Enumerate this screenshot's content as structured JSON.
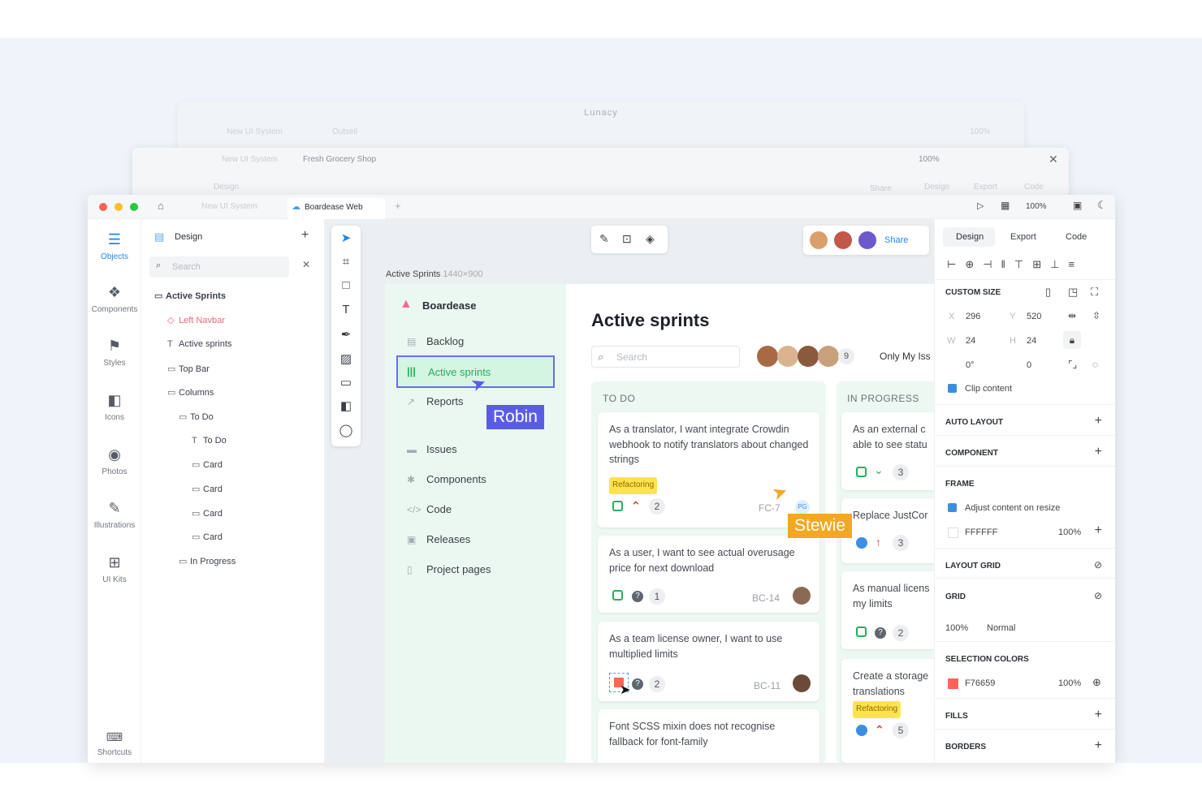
{
  "window_back": {
    "title": "Lunacy",
    "tab1": "New UI System",
    "tab2": "Outsell",
    "zoom": "100%"
  },
  "window_mid": {
    "tab1": "New UI System",
    "tab2": "Fresh Grocery Shop",
    "zoom": "100%",
    "design": "Design",
    "export": "Export",
    "code": "Code",
    "share": "Share"
  },
  "tabs": {
    "home": "home-icon",
    "tab1": "New UI System",
    "tab2": "Boardease Web",
    "zoom": "100%"
  },
  "leftnav": [
    {
      "label": "Objects",
      "icon": "layers-icon"
    },
    {
      "label": "Components",
      "icon": "components-icon"
    },
    {
      "label": "Styles",
      "icon": "paint-roller-icon"
    },
    {
      "label": "Icons",
      "icon": "icons-icon"
    },
    {
      "label": "Photos",
      "icon": "camera-icon"
    },
    {
      "label": "Illustrations",
      "icon": "pen-icon"
    },
    {
      "label": "UI Kits",
      "icon": "grid-icon"
    },
    {
      "label": "Shortcuts",
      "icon": "keyboard-icon"
    }
  ],
  "layers": {
    "page": "Design",
    "search_placeholder": "Search",
    "items": [
      "Active Sprints",
      "Left Navbar",
      "Active sprints",
      "Top Bar",
      "Columns",
      "To Do",
      "To Do",
      "Card",
      "Card",
      "Card",
      "Card",
      "In Progress"
    ]
  },
  "canvas": {
    "frame_name": "Active Sprints",
    "frame_size": "1440×900",
    "share": "Share"
  },
  "app": {
    "brand": "Boardease",
    "menu": [
      "Backlog",
      "Active sprints",
      "Reports",
      "Issues",
      "Components",
      "Code",
      "Releases",
      "Project pages"
    ],
    "title": "Active sprints",
    "search_placeholder": "Search",
    "avatar_count": "9",
    "filter": "Only My Iss",
    "columns": [
      "TO DO",
      "IN PROGRESS"
    ],
    "todo_cards": [
      {
        "text": "As a translator, I want integrate Crowdin webhook to notify translators about changed strings",
        "tag": "Refactoring",
        "count": "2",
        "key": "FC-7"
      },
      {
        "text": "As a user, I want to see actual overusage price for next download",
        "count": "1",
        "key": "BC-14"
      },
      {
        "text": "As a team license owner, I want to use multiplied limits",
        "count": "2",
        "key": "BC-11"
      },
      {
        "text": "Font SCSS mixin does not recognise fallback for font-family"
      }
    ],
    "progress_cards": [
      {
        "text": "As an external c able to see statu",
        "count": "3"
      },
      {
        "text": "Replace JustCor",
        "count": "3"
      },
      {
        "text": "As manual licens my limits",
        "count": "2"
      },
      {
        "text": "Create a storage translations",
        "tag": "Refactoring",
        "count": "5"
      }
    ]
  },
  "cursors": {
    "robin": "Robin",
    "stewie": "Stewie",
    "robin_color": "#5b5ce6",
    "stewie_color": "#f5a623"
  },
  "right_panel": {
    "tabs": [
      "Design",
      "Export",
      "Code"
    ],
    "custom_size": "CUSTOM SIZE",
    "x_label": "X",
    "x": "296",
    "y_label": "Y",
    "y": "520",
    "w_label": "W",
    "w": "24",
    "h_label": "H",
    "h": "24",
    "rot": "0°",
    "radius": "0",
    "clip": "Clip content",
    "auto_layout": "AUTO LAYOUT",
    "component": "COMPONENT",
    "frame": "FRAME",
    "adjust": "Adjust content on resize",
    "fill_hex": "FFFFFF",
    "fill_opacity": "100%",
    "layout_grid": "LAYOUT GRID",
    "grid": "GRID",
    "grid_opacity": "100%",
    "grid_mode": "Normal",
    "selection_colors": "SELECTION COLORS",
    "sel_hex": "F76659",
    "sel_opacity": "100%",
    "sel_color": "#f76659",
    "fills": "FILLS",
    "borders": "BORDERS"
  }
}
